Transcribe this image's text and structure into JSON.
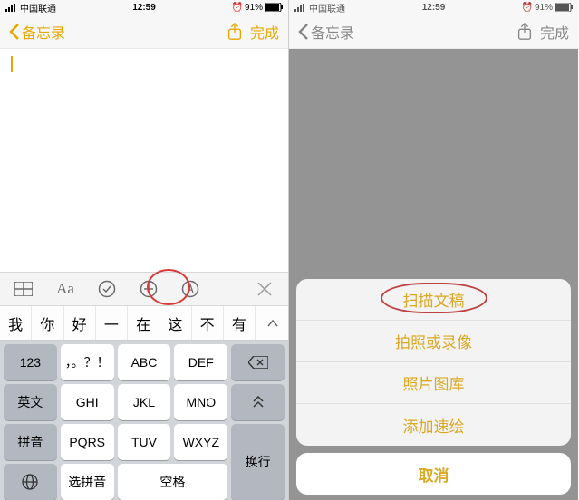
{
  "status": {
    "carrier": "中国联通",
    "time": "12:59",
    "battery": "91%"
  },
  "left": {
    "back_label": "备忘录",
    "done_label": "完成",
    "toolbar": {
      "table_icon": "table-icon",
      "text_format": "Aa",
      "checklist_icon": "checklist-icon",
      "plus_icon": "plus-icon",
      "markup_icon": "markup-icon",
      "close_icon": "close-icon"
    },
    "candidates": [
      "我",
      "你",
      "好",
      "一",
      "在",
      "这",
      "不",
      "有"
    ],
    "keys": {
      "r1": [
        "123",
        "，。？！",
        "ABC",
        "DEF"
      ],
      "r2_mode": "英文",
      "r2": [
        "GHI",
        "JKL",
        "MNO"
      ],
      "r3_mode": "拼音",
      "r3": [
        "PQRS",
        "TUV",
        "WXYZ"
      ],
      "r4_select": "选拼音",
      "r4_space": "空格",
      "r_enter": "换行",
      "r_backspace": "⌫",
      "r_collapse": "⌃"
    }
  },
  "right": {
    "back_label": "备忘录",
    "done_label": "完成",
    "sheet": {
      "items": [
        "扫描文稿",
        "拍照或录像",
        "照片图库",
        "添加速绘"
      ],
      "cancel": "取消"
    }
  }
}
